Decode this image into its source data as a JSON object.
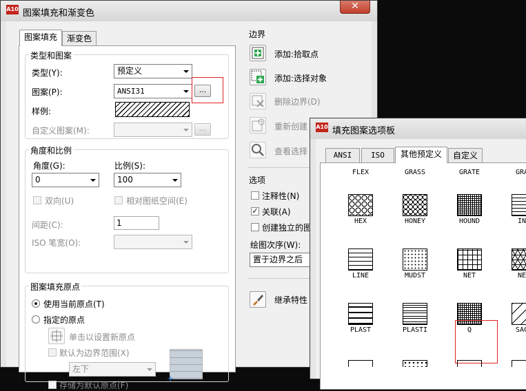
{
  "main_dialog": {
    "title": "图案填充和渐变色",
    "close": "✕",
    "tabs": [
      "图案填充",
      "渐变色"
    ],
    "type_group": {
      "title": "类型和图案",
      "type_label": "类型(Y):",
      "type_value": "预定义",
      "pattern_label": "图案(P):",
      "pattern_value": "ANSI31",
      "browse": "...",
      "sample_label": "样例:",
      "custom_label": "自定义图案(M):",
      "custom_browse": "..."
    },
    "angle_group": {
      "title": "角度和比例",
      "angle_label": "角度(G):",
      "angle_value": "0",
      "scale_label": "比例(S):",
      "scale_value": "100",
      "double_label": "双向(U)",
      "relative_label": "相对图纸空间(E)",
      "spacing_label": "间距(C):",
      "spacing_value": "1",
      "iso_label": "ISO 笔宽(O):"
    },
    "origin_group": {
      "title": "图案填充原点",
      "use_current": "使用当前原点(T)",
      "specified": "指定的原点",
      "click_set": "单击以设置新原点",
      "default_extent": "默认为边界范围(X)",
      "extent_value": "左下",
      "store_default": "存储为默认原点(F)"
    },
    "boundary": {
      "title": "边界",
      "add_pick": "添加:拾取点",
      "add_select": "添加:选择对象",
      "remove": "删除边界(D)",
      "recreate": "重新创建",
      "view": "查看选择"
    },
    "options": {
      "title": "选项",
      "annotative": "注释性(N)",
      "associative": "关联(A)",
      "independent": "创建独立的图",
      "draw_order_label": "绘图次序(W):",
      "draw_order_value": "置于边界之后"
    },
    "inherit": "继承特性"
  },
  "palette": {
    "title": "填充图案选项板",
    "tabs": [
      "ANSI",
      "ISO",
      "其他预定义",
      "自定义"
    ],
    "top_names": [
      "FLEX",
      "GRASS",
      "GRATE",
      "GRAV"
    ],
    "rows": [
      [
        "HEX",
        "HONEY",
        "HOUND",
        "INS"
      ],
      [
        "LINE",
        "MUDST",
        "NET",
        "NET"
      ],
      [
        "PLAST",
        "PLASTI",
        "Q",
        "SACK"
      ]
    ]
  }
}
